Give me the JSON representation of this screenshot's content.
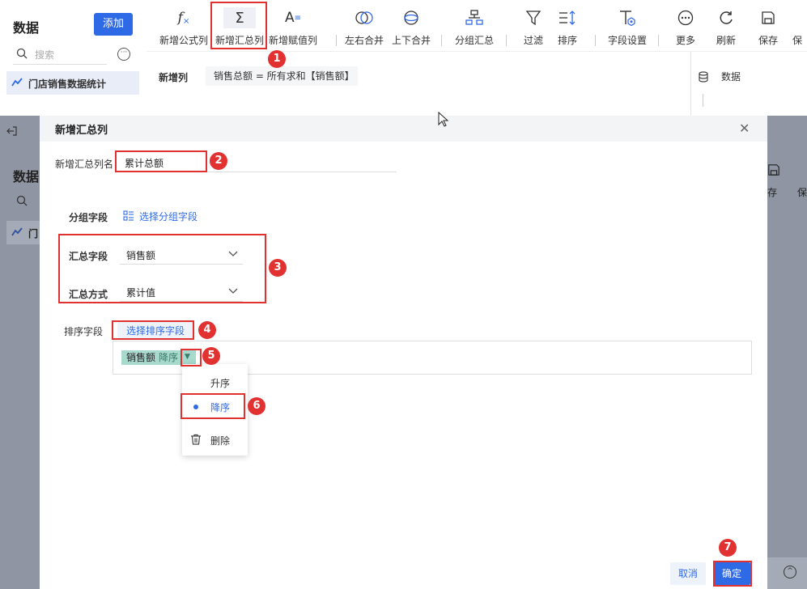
{
  "left_panel": {
    "title": "数据",
    "add_button": "添加",
    "search_placeholder": "搜索",
    "item": "门店销售数据统计"
  },
  "toolbar": {
    "items": [
      {
        "label": "新增公式列",
        "icon": "formula-icon"
      },
      {
        "label": "新增汇总列",
        "icon": "sigma-icon"
      },
      {
        "label": "新增赋值列",
        "icon": "assign-icon"
      },
      {
        "label": "左右合并",
        "icon": "merge-horizontal-icon"
      },
      {
        "label": "上下合并",
        "icon": "merge-vertical-icon"
      },
      {
        "label": "分组汇总",
        "icon": "group-summary-icon"
      },
      {
        "label": "过滤",
        "icon": "filter-icon"
      },
      {
        "label": "排序",
        "icon": "sort-icon"
      },
      {
        "label": "字段设置",
        "icon": "field-settings-icon"
      },
      {
        "label": "更多",
        "icon": "more-icon"
      },
      {
        "label": "刷新",
        "icon": "refresh-icon"
      },
      {
        "label": "保存",
        "icon": "save-icon"
      },
      {
        "label": "保"
      }
    ]
  },
  "formula_area": {
    "label": "新增列",
    "expression": "销售总额 = 所有求和【销售额】"
  },
  "right_panel": {
    "label": "数据"
  },
  "overlay": {
    "title": "数据",
    "item_prefix": "门",
    "save1": "存",
    "save2": "保"
  },
  "dialog": {
    "title": "新增汇总列",
    "name_label": "新增汇总列名",
    "name_value": "累计总额",
    "group_label": "分组字段",
    "group_pick": "选择分组字段",
    "agg_field_label": "汇总字段",
    "agg_field_value": "销售额",
    "agg_method_label": "汇总方式",
    "agg_method_value": "累计值",
    "sort_label": "排序字段",
    "sort_pick": "选择排序字段",
    "sort_tag_field": "销售额",
    "sort_tag_dir": "降序",
    "menu": {
      "asc": "升序",
      "desc": "降序",
      "delete": "删除"
    },
    "cancel": "取消",
    "ok": "确定"
  },
  "annotations": [
    "1",
    "2",
    "3",
    "4",
    "5",
    "6",
    "7"
  ],
  "colors": {
    "accent": "#2f6ae6",
    "highlight": "#e23131",
    "tag": "#a7d9cc"
  }
}
